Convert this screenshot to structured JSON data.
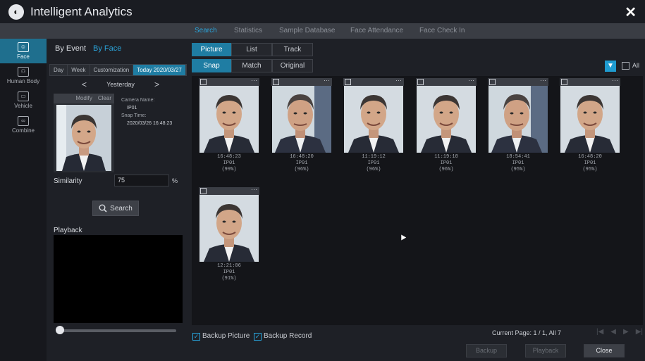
{
  "app": {
    "title": "Intelligent Analytics"
  },
  "tabs": [
    {
      "label": "Search",
      "active": true
    },
    {
      "label": "Statistics"
    },
    {
      "label": "Sample Database"
    },
    {
      "label": "Face Attendance"
    },
    {
      "label": "Face Check In"
    }
  ],
  "leftnav": [
    {
      "label": "Face",
      "icon": "face-icon",
      "active": true
    },
    {
      "label": "Human Body",
      "icon": "human-body-icon"
    },
    {
      "label": "Vehicle",
      "icon": "vehicle-icon"
    },
    {
      "label": "Combine",
      "icon": "combine-icon"
    }
  ],
  "search_panel": {
    "by_event": "By Event",
    "by_face": "By Face",
    "time_tabs": [
      "Day",
      "Week",
      "Customization",
      "Today 2020/03/27"
    ],
    "day_label": "Yesterday",
    "prev_arrow": "<",
    "next_arrow": ">",
    "modify": "Modify",
    "clear": "Clear",
    "camera_name_label": "Camera Name:",
    "camera_name": "IP01",
    "snap_time_label": "Snap Time:",
    "snap_time": "2020/03/26 16:48:23",
    "similarity_label": "Similarity",
    "similarity_value": "75",
    "similarity_unit": "%",
    "search_button": "Search",
    "playback_label": "Playback",
    "playback_progress": 0.0
  },
  "view_modes": [
    "Picture",
    "List",
    "Track"
  ],
  "image_modes": [
    "Snap",
    "Match",
    "Original"
  ],
  "filter": {
    "all_label": "All"
  },
  "results": [
    {
      "time": "16:48:23",
      "camera": "IP01",
      "similarity": "(99%)"
    },
    {
      "time": "16:48:20",
      "camera": "IP01",
      "similarity": "(96%)"
    },
    {
      "time": "11:19:12",
      "camera": "IP01",
      "similarity": "(96%)"
    },
    {
      "time": "11:19:10",
      "camera": "IP01",
      "similarity": "(96%)"
    },
    {
      "time": "18:54:41",
      "camera": "IP01",
      "similarity": "(95%)"
    },
    {
      "time": "16:48:20",
      "camera": "IP01",
      "similarity": "(95%)"
    },
    {
      "time": "12:21:06",
      "camera": "IP01",
      "similarity": "(91%)"
    }
  ],
  "footer": {
    "backup_picture": "Backup Picture",
    "backup_record": "Backup Record",
    "page_info": "Current Page: 1 / 1, All 7",
    "backup": "Backup",
    "playback": "Playback",
    "close": "Close"
  }
}
